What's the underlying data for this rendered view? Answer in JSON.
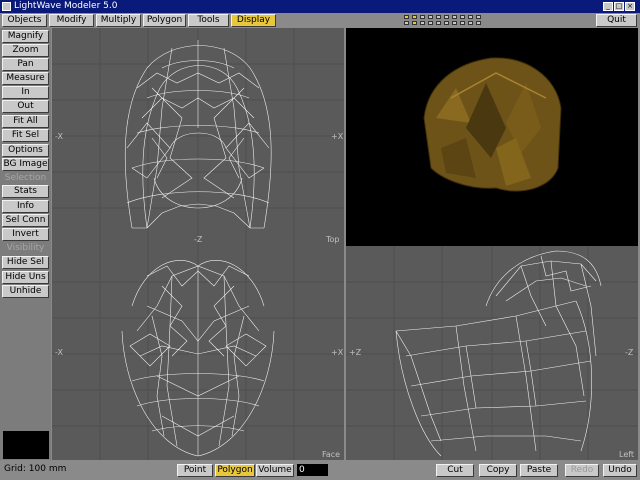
{
  "window": {
    "title": "LightWave Modeler 5.0"
  },
  "menubar": {
    "tabs": [
      {
        "label": "Objects"
      },
      {
        "label": "Modify"
      },
      {
        "label": "Multiply"
      },
      {
        "label": "Polygon"
      },
      {
        "label": "Tools"
      },
      {
        "label": "Display",
        "active": true
      }
    ],
    "quit_label": "Quit"
  },
  "sidebar": {
    "buttons_view": [
      "Magnify",
      "Zoom",
      "Pan",
      "Measure",
      "In",
      "Out",
      "Fit All",
      "Fit Sel",
      "Options",
      "BG Image"
    ],
    "selection_label": "Selection",
    "buttons_selection": [
      "Stats",
      "Info",
      "Sel Conn",
      "Invert"
    ],
    "visibility_label": "Visibility",
    "buttons_visibility": [
      "Hide Sel",
      "Hide Uns",
      "Unhide"
    ]
  },
  "viewports": {
    "top": {
      "label": "Top",
      "axis_left": "-X",
      "axis_right": "+X",
      "axis_bottom": "-Z"
    },
    "face": {
      "label": "Face",
      "axis_left": "-X",
      "axis_right": "+X"
    },
    "left": {
      "label": "Left",
      "axis_left": "+Z",
      "axis_right": "-Z"
    }
  },
  "statusbar": {
    "grid": "Grid: 100 mm",
    "modes": [
      "Point",
      "Polygon",
      "Volume"
    ],
    "active_mode": "Polygon",
    "field_value": "0",
    "actions": [
      "Cut",
      "Copy",
      "Paste",
      "Redo",
      "Undo"
    ]
  },
  "colors": {
    "accent": "#e8c83a",
    "button": "#c9c9c9",
    "viewport": "#5a5a5a",
    "titlebar": "#0a1a7a",
    "render": "#6e5318"
  }
}
